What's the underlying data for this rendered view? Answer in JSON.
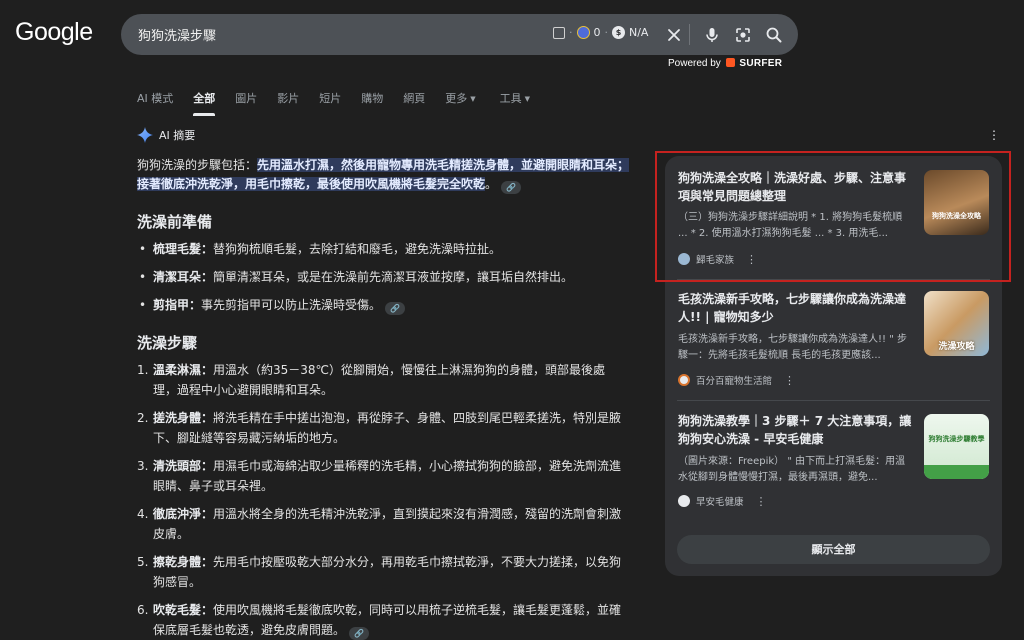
{
  "header": {
    "logo": "Google",
    "query": "狗狗洗澡步驟",
    "ext_count": "0",
    "ext_na": "N/A",
    "powered_by": "Powered by",
    "surfer": "SURFER"
  },
  "tabs": [
    {
      "label": "AI 模式",
      "active": false
    },
    {
      "label": "全部",
      "active": true
    },
    {
      "label": "圖片",
      "active": false
    },
    {
      "label": "影片",
      "active": false
    },
    {
      "label": "短片",
      "active": false
    },
    {
      "label": "購物",
      "active": false
    },
    {
      "label": "網頁",
      "active": false
    },
    {
      "label": "更多",
      "active": false
    },
    {
      "label": "工具",
      "active": false
    }
  ],
  "ai": {
    "title": "AI 摘要",
    "intro_plain": "狗狗洗澡的步驟包括：",
    "intro_highlight": "先用溫水打濕，然後用寵物專用洗毛精搓洗身體，並避開眼睛和耳朵；接著徹底沖洗乾淨，用毛巾擦乾，最後使用吹風機將毛髮完全吹乾",
    "intro_end": "。",
    "prep_heading": "洗澡前準備",
    "prep": [
      {
        "term": "梳理毛髮：",
        "text": "替狗狗梳順毛髮，去除打結和廢毛，避免洗澡時拉扯。"
      },
      {
        "term": "清潔耳朵：",
        "text": "簡單清潔耳朵，或是在洗澡前先滴潔耳液並按摩，讓耳垢自然排出。"
      },
      {
        "term": "剪指甲：",
        "text": "事先剪指甲可以防止洗澡時受傷。"
      }
    ],
    "steps_heading": "洗澡步驟",
    "steps": [
      {
        "num": "1.",
        "term": "溫柔淋濕：",
        "text": "用溫水（約35－38℃）從腳開始，慢慢往上淋濕狗狗的身體，頭部最後處理，過程中小心避開眼睛和耳朵。"
      },
      {
        "num": "2.",
        "term": "搓洗身體：",
        "text": "將洗毛精在手中搓出泡泡，再從脖子、身體、四肢到尾巴輕柔搓洗，特別是腋下、腳趾縫等容易藏污納垢的地方。"
      },
      {
        "num": "3.",
        "term": "清洗頭部：",
        "text": "用濕毛巾或海綿沾取少量稀釋的洗毛精，小心擦拭狗狗的臉部，避免洗劑流進眼睛、鼻子或耳朵裡。"
      },
      {
        "num": "4.",
        "term": "徹底沖淨：",
        "text": "用溫水將全身的洗毛精沖洗乾淨，直到摸起來沒有滑潤感，殘留的洗劑會刺激皮膚。"
      },
      {
        "num": "5.",
        "term": "擦乾身體：",
        "text": "先用毛巾按壓吸乾大部分水分，再用乾毛巾擦拭乾淨，不要大力搓揉，以免狗狗感冒。"
      },
      {
        "num": "6.",
        "term": "吹乾毛髮：",
        "text": "使用吹風機將毛髮徹底吹乾，同時可以用梳子逆梳毛髮，讓毛髮更蓬鬆，並確保底層毛髮也乾透，避免皮膚問題。"
      }
    ]
  },
  "sources": [
    {
      "title": "狗狗洗澡全攻略｜洗澡好處、步驟、注意事項與常見問題總整理",
      "snippet": "（三）狗狗洗澡步驟詳細說明 * 1. 將狗狗毛髮梳順 ... * 2. 使用溫水打濕狗狗毛髮 ... * 3. 用洗毛...",
      "site": "歸毛家族",
      "thumb_text": "狗狗洗澡全攻略"
    },
    {
      "title": "毛孩洗澡新手攻略，七步驟讓你成為洗澡達人!! | 寵物知多少",
      "snippet": "毛孩洗澡新手攻略，七步驟讓你成為洗澡達人!! \" 步驟一：先將毛孩毛髮梳順 長毛的毛孩更應該...",
      "site": "百分百寵物生活館",
      "thumb_text": "洗澡攻略"
    },
    {
      "title": "狗狗洗澡教學｜3 步驟＋ 7 大注意事項，讓狗狗安心洗澡 - 早安毛健康",
      "snippet": "（圖片來源：Freepik） \" 由下而上打濕毛髮：用溫水從腳到身體慢慢打濕，最後再濕頭，避免...",
      "site": "早安毛健康",
      "thumb_text": "狗狗洗澡步驟教學"
    }
  ],
  "show_all": "顯示全部",
  "colors": {
    "highlight_bg": "#2f3b5c",
    "frame": "#c5221f",
    "panel": "#303134"
  }
}
